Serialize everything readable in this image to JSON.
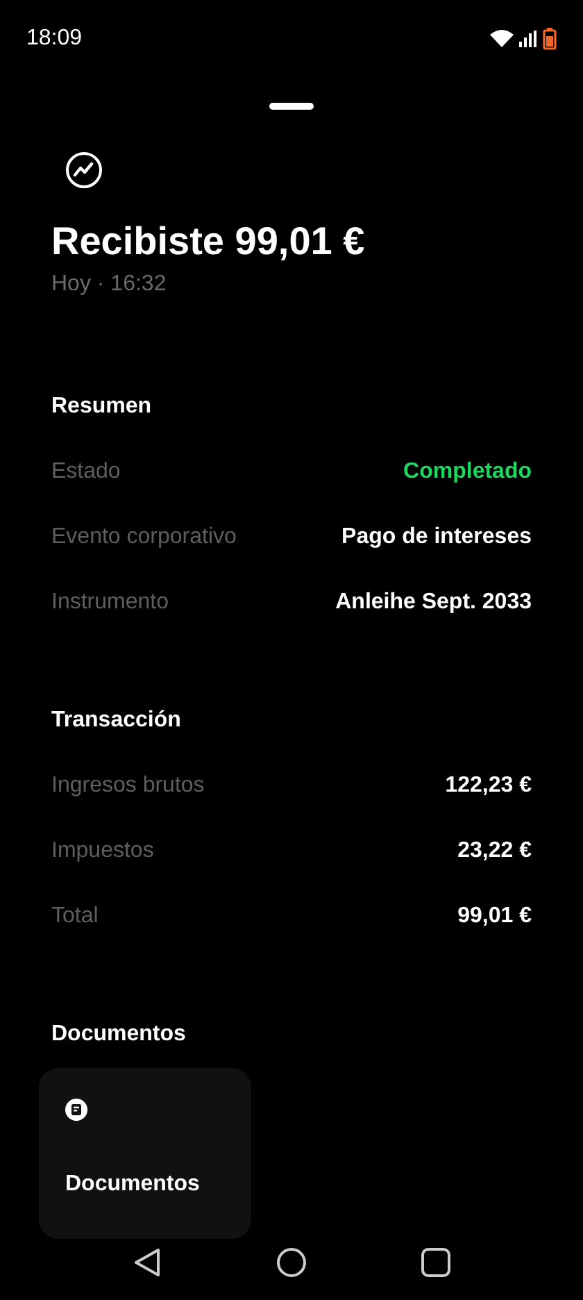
{
  "status_bar": {
    "time": "18:09"
  },
  "header": {
    "title": "Recibiste 99,01 €",
    "subtitle": "Hoy · 16:32"
  },
  "sections": [
    {
      "title": "Resumen",
      "rows": [
        {
          "label": "Estado",
          "value": "Completado",
          "kind": "status"
        },
        {
          "label": "Evento corporativo",
          "value": "Pago de intereses",
          "kind": "text"
        },
        {
          "label": "Instrumento",
          "value": "Anleihe Sept. 2033",
          "kind": "text"
        }
      ]
    },
    {
      "title": "Transacción",
      "rows": [
        {
          "label": "Ingresos brutos",
          "value": "122,23 €",
          "kind": "text"
        },
        {
          "label": "Impuestos",
          "value": "23,22 €",
          "kind": "text"
        },
        {
          "label": "Total",
          "value": "99,01 €",
          "kind": "text"
        }
      ]
    }
  ],
  "documents": {
    "title": "Documentos",
    "cards": [
      {
        "label": "Documentos"
      }
    ]
  }
}
